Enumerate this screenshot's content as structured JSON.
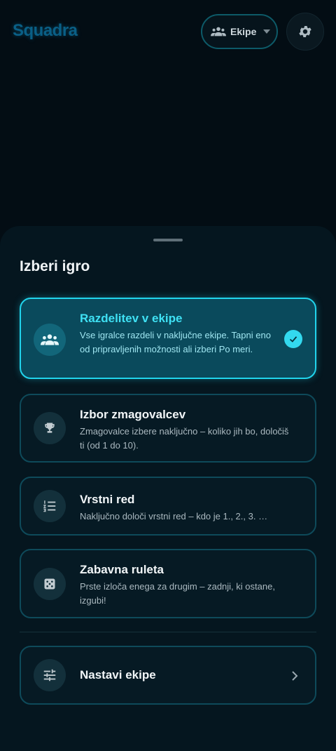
{
  "app": {
    "logo": "Squadra",
    "team_selector_label": "Ekipe"
  },
  "sheet": {
    "title": "Izberi igro",
    "games": [
      {
        "title": "Razdelitev v ekipe",
        "description": "Vse igralce razdeli v naključne ekipe. Tapni eno od pripravljenih možnosti ali izberi Po meri.",
        "icon": "groups-icon",
        "selected": true
      },
      {
        "title": "Izbor zmagovalcev",
        "description": "Zmagovalce izbere naključno – koliko jih bo, določiš ti (od 1 do 10).",
        "icon": "trophy-icon",
        "selected": false
      },
      {
        "title": "Vrstni red",
        "description": "Naključno določi vrstni red – kdo je 1., 2., 3. …",
        "icon": "numbered-list-icon",
        "selected": false
      },
      {
        "title": "Zabavna ruleta",
        "description": "Prste izloča enega za drugim – zadnji, ki ostane, izgubi!",
        "icon": "dice-icon",
        "selected": false
      }
    ],
    "setup_teams": {
      "label": "Nastavi ekipe",
      "icon": "tune-icon"
    }
  },
  "colors": {
    "accent": "#21d4ec",
    "background": "#030d14",
    "sheet": "#05161f"
  }
}
